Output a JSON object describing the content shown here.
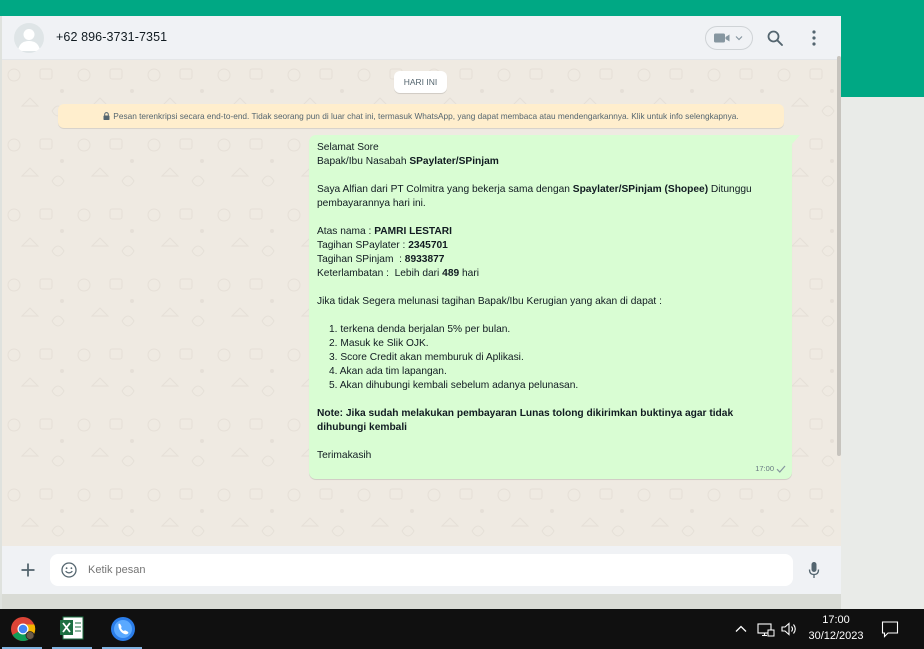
{
  "header": {
    "contact_name": "+62 896-3731-7351",
    "icons": [
      "avatar-default",
      "video-call-icon",
      "chevron-down-icon",
      "search-icon",
      "menu-icon"
    ]
  },
  "chat": {
    "date_chip": "HARI INI",
    "encryption_note": "Pesan terenkripsi secara end-to-end. Tidak seorang pun di luar chat ini, termasuk WhatsApp, yang dapat membaca atau mendengarkannya. Klik untuk info selengkapnya.",
    "message": {
      "greeting": "Selamat Sore",
      "addressee_prefix": "Bapak/Ibu Nasabah ",
      "addressee_bold": "SPaylater/SPinjam",
      "intro_text": "Saya Alfian dari PT Colmitra yang bekerja sama dengan ",
      "intro_bold": "Spaylater/SPinjam (Shopee)",
      "intro_suffix": " Ditunggu",
      "intro_line2": "pembayarannya hari ini.",
      "name_label": "Atas nama : ",
      "name_value": "PAMRI LESTARI",
      "spaylater_label": "Tagihan SPaylater : ",
      "spaylater_value": "2345701",
      "spinjam_label": "Tagihan SPinjam  : ",
      "spinjam_value": "8933877",
      "late_label": "Keterlambatan :  Lebih dari ",
      "late_value": "489",
      "late_suffix": " hari",
      "warning": "Jika tidak Segera melunasi tagihan Bapak/Ibu Kerugian yang akan di dapat :",
      "consequences": [
        "1. terkena denda berjalan 5% per bulan.",
        "2. Masuk ke Slik OJK.",
        "3. Score Credit akan memburuk di Aplikasi.",
        "4. Akan ada tim lapangan.",
        "5. Akan dihubungi kembali sebelum adanya pelunasan."
      ],
      "note": "Note: Jika sudah melakukan pembayaran Lunas tolong dikirimkan buktinya agar tidak dihubungi kembali",
      "closing": "Terimakasih",
      "time": "17:00",
      "status": "sent-check-icon"
    }
  },
  "composer": {
    "placeholder": "Ketik pesan",
    "icons": [
      "plus-icon",
      "emoji-icon",
      "mic-icon"
    ]
  },
  "taskbar": {
    "apps": [
      "chrome-icon",
      "excel-icon",
      "phone-app-icon"
    ],
    "time": "17:00",
    "date": "30/12/2023"
  },
  "colors": {
    "accent": "#00a884",
    "bubble_out": "#d9fdd3",
    "chat_bg": "#efeae2",
    "header_bg": "#f0f2f5",
    "enc_bg": "#ffeecd"
  }
}
